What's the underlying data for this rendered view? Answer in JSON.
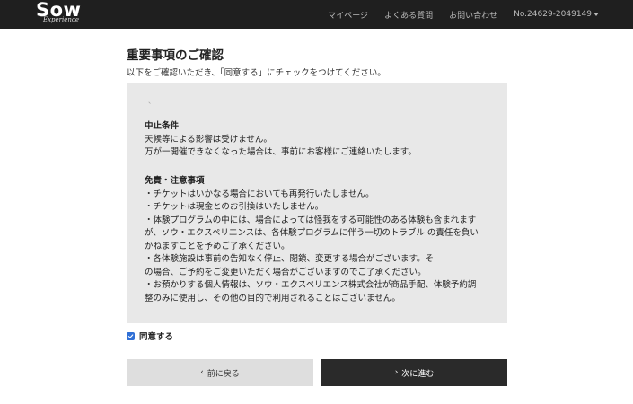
{
  "header": {
    "logo_text": "Sow",
    "logo_sub": "Experience",
    "nav": [
      "マイページ",
      "よくある質問",
      "お問い合わせ"
    ],
    "member_no": "No.24629-2049149"
  },
  "page": {
    "title": "重要事項のご確認",
    "instruction": "以下をご確認いただき、「同意する」にチェックをつけてください。"
  },
  "terms": {
    "ellipsis": "、",
    "cancellation_title": "中止条件",
    "cancellation_lines": [
      "天候等による影響は受けません。",
      "万が一開催できなくなった場合は、事前にお客様にご連絡いたします。"
    ],
    "disclaimer_title": "免責・注意事項",
    "disclaimer_lines": [
      "・チケットはいかなる場合においても再発行いたしません。",
      "・チケットは現金とのお引換はいたしません。",
      "・体験プログラムの中には、場合によっては怪我をする可能性のある体験も含まれます",
      "が、ソウ・エクスペリエンスは、各体験プログラムに伴う一切のトラブル の責任を負い",
      "かねますことを予めご了承ください。",
      "・各体験施設は事前の告知なく停止、閉鎖、変更する場合がございます。そ",
      "の場合、ご予約をご変更いただく場合がございますのでご了承ください。",
      "・お預かりする個人情報は、ソウ・エクスペリエンス株式会社が商品手配、体験予約調",
      "整のみに使用し、その他の目的で利用されることはございません。"
    ]
  },
  "agree": {
    "label": "同意する",
    "checked": true,
    "color": "#2f6fd6"
  },
  "buttons": {
    "back": "前に戻る",
    "next": "次に進む"
  }
}
